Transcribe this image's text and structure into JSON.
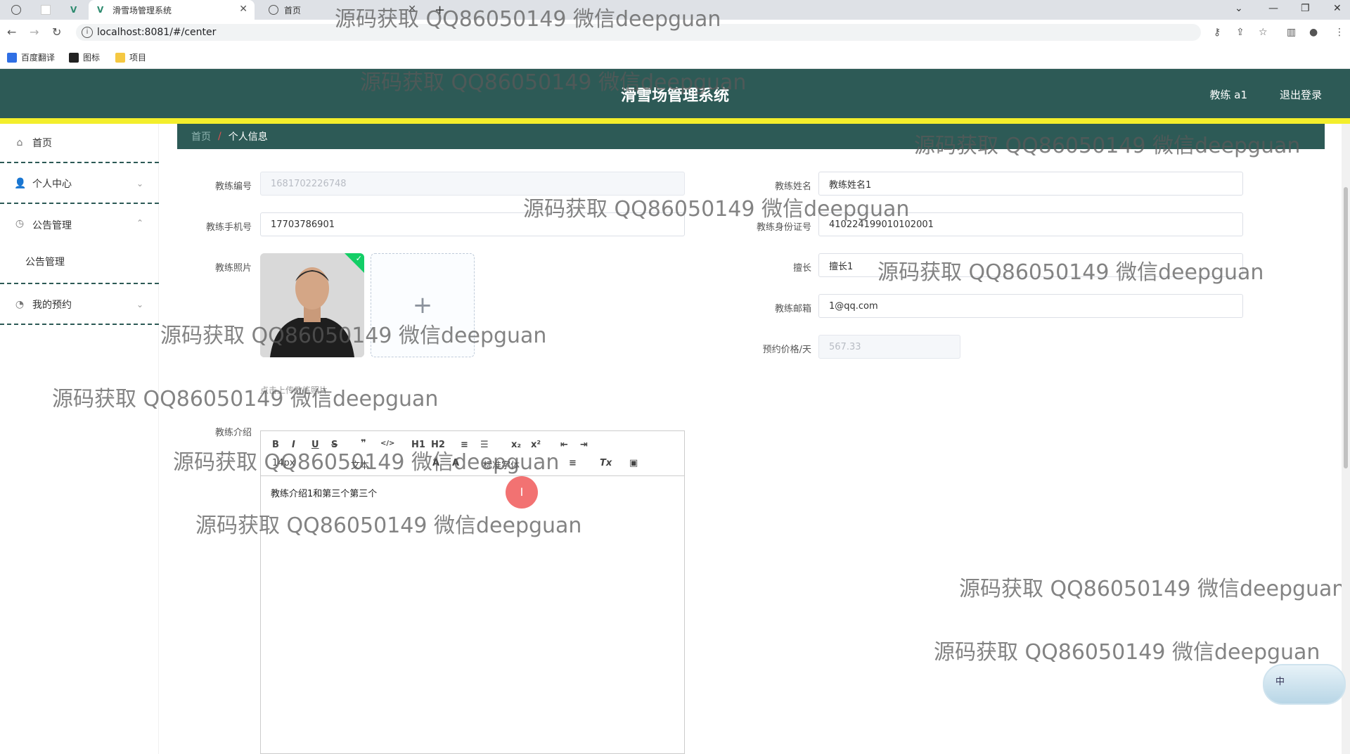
{
  "browser": {
    "tabs": [
      {
        "label": ""
      },
      {
        "label": ""
      },
      {
        "label": ""
      },
      {
        "label": "滑雪场管理系统",
        "active": true
      },
      {
        "label": "首页"
      }
    ],
    "new_tab": "+",
    "url": "localhost:8081/#/center",
    "bookmarks": [
      "百度翻译",
      "图标",
      "项目"
    ]
  },
  "app": {
    "title": "滑雪场管理系统",
    "user": "教练 a1",
    "logout": "退出登录"
  },
  "sidebar": {
    "items": [
      {
        "label": "首页",
        "icon": "home-icon"
      },
      {
        "label": "个人中心",
        "icon": "user-icon"
      },
      {
        "label": "公告管理",
        "icon": "clock-icon",
        "sub": "公告管理"
      },
      {
        "label": "我的预约",
        "icon": "compass-icon"
      }
    ]
  },
  "breadcrumb": {
    "home": "首页",
    "sep": "/",
    "current": "个人信息"
  },
  "form": {
    "coach_no": {
      "label": "教练编号",
      "value": "1681702226748"
    },
    "coach_name": {
      "label": "教练姓名",
      "value": "教练姓名1"
    },
    "phone": {
      "label": "教练手机号",
      "value": "17703786901"
    },
    "id_card": {
      "label": "教练身份证号",
      "value": "410224199010102001"
    },
    "photo": {
      "label": "教练照片",
      "upload_tip": "点击上传教练照片"
    },
    "specialty": {
      "label": "擅长",
      "value": "擅长1"
    },
    "email": {
      "label": "教练邮箱",
      "value": "1@qq.com"
    },
    "price": {
      "label": "预约价格/天",
      "value": "567.33"
    },
    "intro": {
      "label": "教练介绍",
      "value": "教练介绍1和第三个第三个"
    }
  },
  "editor_toolbar": {
    "row1": [
      "B",
      "I",
      "U",
      "S",
      "❞",
      "</>",
      "H1",
      "H2",
      "≡",
      "☰",
      "x₂",
      "x²",
      "⇤",
      "⇥"
    ],
    "row2": [
      "14px",
      "文本",
      "A",
      "A",
      "标准字体",
      "≡",
      "Tx",
      "▣"
    ]
  },
  "watermark": "源码获取 QQ86050149 微信deepguan",
  "ime": "中"
}
